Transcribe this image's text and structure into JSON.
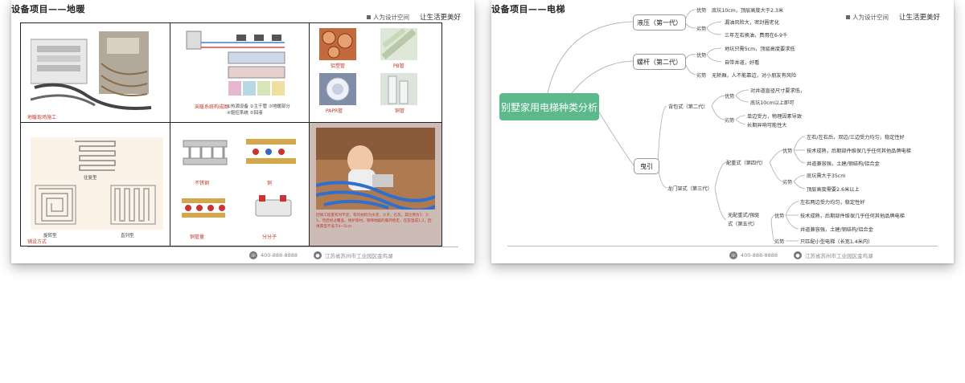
{
  "left_slide": {
    "title": "设备项目——地暖",
    "brand_left": "人为设计空间",
    "brand_slogan": "让生活更美好",
    "captions": {
      "construction": "地暖现场施工",
      "system": "采暖系统构成图",
      "system_legend_1": "①热源设备 ②主干管 ③地暖部分",
      "system_legend_2": "④驱控系统 ⑤回液",
      "pipe_1": "铝塑管",
      "pipe_2": "PB管",
      "pipe_3": "PAPR管",
      "pipe_4": "铜管",
      "layout": "铺设方式",
      "layout_a": "往复型",
      "layout_b": "旋转型",
      "layout_c": "直列型",
      "manifold_1": "不锈钢",
      "manifold_2": "铜",
      "manifold_3": "铜管量",
      "manifold_4": "分分子",
      "baby_note": "回填工程量有时不足，有的材料为水泥，沙子，石灰，其比例为1：3：5，然后经过覆盖，保护管材。保障地暖的循环稳定，在室温成1.2，回填厚度不低于4~5cm"
    },
    "footer_phone": "400-888-8888",
    "footer_address": "江苏省苏州市工业园区金鸡湖"
  },
  "right_slide": {
    "title": "设备项目——电梯",
    "brand_left": "人为设计空间",
    "brand_slogan": "让生活更美好",
    "root": "别墅家用电梯种类分析",
    "hydraulic": {
      "label": "液压（第一代）",
      "pro_label": "优势",
      "pro_1": "底坑10cm，顶层高度大于2.3米",
      "con_label": "劣势",
      "con_1": "漏油风险大，密封圈老化",
      "con_2": "三年左右换油，费用在6-9千"
    },
    "screw": {
      "label": "螺杆（第二代）",
      "pro_label": "优势",
      "pro_1": "地坑只需5cm，顶层高度要求低",
      "pro_2": "自带井道，好看",
      "con_label": "劣势",
      "con_1": "无轿厢，人不能靠边，对小朋友有风险"
    },
    "traction": {
      "label": "曳引",
      "backpack": {
        "label": "背包式（第二代）",
        "pro_label": "优势",
        "pro_1": "对井道直径尺寸要求低，",
        "pro_2": "底坑10cm以上即可",
        "con_label": "劣势",
        "con_1": "单边受力，物理因素导致",
        "con_2": "长期异响可能性大"
      },
      "gantry": {
        "label": "龙门架式（第三代）",
        "counterweight": {
          "label": "配重式（第四代）",
          "pro_label": "优势",
          "pro_1": "左右/左右后，双边/三边受力均匀，稳定性好",
          "pro_2": "技术成熟，后期部件维保几乎任何其他品牌电梯",
          "pro_3": "井道兼容强，土建/钢结构/铝合金",
          "con_label": "劣势",
          "con_1": "底坑需大于35cm",
          "con_2": "顶层高度需要2.6米以上"
        },
        "no_counterweight": {
          "label_1": "无配重式/强驱",
          "label_2": "式（第五代）",
          "pro_label": "优势",
          "pro_1": "左右两边受力均匀，稳定性好",
          "pro_2": "技术成熟，后期部件维保几乎任何其他品牌电梯",
          "pro_3": "井道兼容强，土建/钢结构/铝合金",
          "con_label": "劣势",
          "con_1": "只匹配小型电梯（长宽1.4米内）"
        }
      }
    },
    "footer_phone": "400-888-8888",
    "footer_address": "江苏省苏州市工业园区金鸡湖"
  },
  "colors": {
    "root_green": "#5bb98c",
    "caption_red": "#c0392b",
    "grid_border": "#222222"
  }
}
